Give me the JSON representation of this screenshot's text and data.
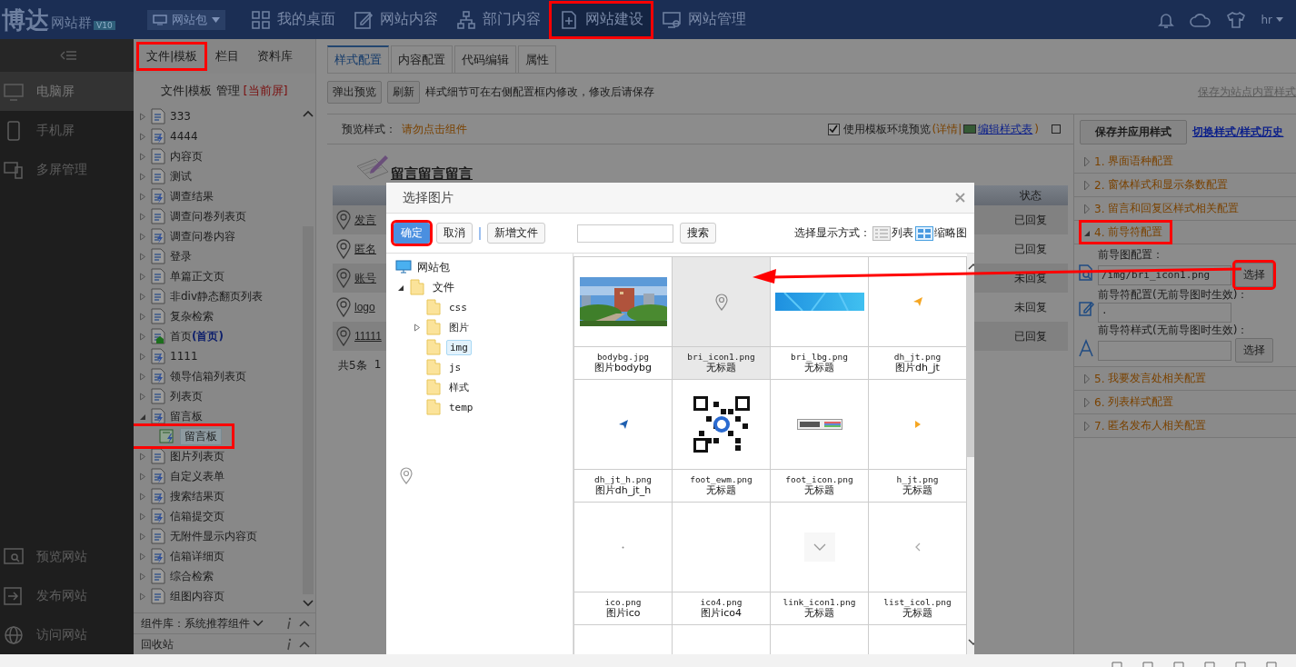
{
  "topbar": {
    "logo": "博达",
    "product": "网站群",
    "version": "V10",
    "site_select": "网站包",
    "user": "hr",
    "nav": [
      {
        "label": "我的桌面",
        "kind": "grid",
        "selected": false,
        "marked": false
      },
      {
        "label": "网站内容",
        "kind": "edit",
        "selected": false,
        "marked": false
      },
      {
        "label": "部门内容",
        "kind": "sitemap",
        "selected": false,
        "marked": false
      },
      {
        "label": "网站建设",
        "kind": "add-page",
        "selected": true,
        "marked": true
      },
      {
        "label": "网站管理",
        "kind": "monitor",
        "selected": false,
        "marked": false
      }
    ]
  },
  "sidebar": {
    "items": [
      {
        "label": "电脑屏",
        "kind": "monitor",
        "selected": true
      },
      {
        "label": "手机屏",
        "kind": "phone",
        "selected": false
      },
      {
        "label": "多屏管理",
        "kind": "multi",
        "selected": false
      }
    ],
    "bottom_items": [
      {
        "label": "预览网站",
        "kind": "preview"
      },
      {
        "label": "发布网站",
        "kind": "publish"
      },
      {
        "label": "访问网站",
        "kind": "globe"
      }
    ]
  },
  "tree_panel": {
    "tabs": [
      {
        "label": "文件|模板",
        "marked": true
      },
      {
        "label": "栏目",
        "marked": false
      },
      {
        "label": "资料库",
        "marked": false
      }
    ],
    "heading": "文件|模板 管理",
    "heading_badge": "[当前屏]",
    "items": [
      {
        "label": "333",
        "kind": "page",
        "expanded": false
      },
      {
        "label": "4444",
        "kind": "dynamic",
        "expanded": false
      },
      {
        "label": "内容页",
        "kind": "page",
        "expanded": false
      },
      {
        "label": "测试",
        "kind": "page",
        "expanded": false
      },
      {
        "label": "调查结果",
        "kind": "dynamic",
        "expanded": false
      },
      {
        "label": "调查问卷列表页",
        "kind": "page",
        "expanded": false
      },
      {
        "label": "调查问卷内容",
        "kind": "dynamic",
        "expanded": false
      },
      {
        "label": "登录",
        "kind": "page",
        "expanded": false
      },
      {
        "label": "单篇正文页",
        "kind": "page",
        "expanded": false
      },
      {
        "label": "非div静态翻页列表",
        "kind": "page",
        "expanded": false
      },
      {
        "label": "复杂检索",
        "kind": "page",
        "expanded": false
      },
      {
        "label": "首页",
        "tag": "(首页)",
        "kind": "home",
        "expanded": false
      },
      {
        "label": "1111",
        "kind": "dynamic",
        "expanded": false
      },
      {
        "label": "领导信箱列表页",
        "kind": "dynamic",
        "expanded": false
      },
      {
        "label": "列表页",
        "kind": "page",
        "expanded": false
      },
      {
        "label": "留言板",
        "kind": "dynamic",
        "expanded": true,
        "children": [
          {
            "label": "留言板",
            "kind": "edit",
            "selected": true,
            "marked": true
          }
        ]
      },
      {
        "label": "图片列表页",
        "kind": "page",
        "expanded": false
      },
      {
        "label": "自定义表单",
        "kind": "dynamic",
        "expanded": false
      },
      {
        "label": "搜索结果页",
        "kind": "dynamic",
        "expanded": false
      },
      {
        "label": "信箱提交页",
        "kind": "dynamic",
        "expanded": false
      },
      {
        "label": "无附件显示内容页",
        "kind": "page",
        "expanded": false
      },
      {
        "label": "信箱详细页",
        "kind": "dynamic",
        "expanded": false
      },
      {
        "label": "综合检索",
        "kind": "page",
        "expanded": false
      },
      {
        "label": "组图内容页",
        "kind": "page",
        "expanded": false
      }
    ],
    "footer": [
      {
        "label": "组件库：系统推荐组件",
        "dropdown": true
      },
      {
        "label": "回收站",
        "dropdown": false
      }
    ]
  },
  "main": {
    "tabs": [
      {
        "label": "样式配置",
        "selected": true
      },
      {
        "label": "内容配置",
        "selected": false
      },
      {
        "label": "代码编辑",
        "selected": false
      },
      {
        "label": "属性",
        "selected": false
      }
    ],
    "buttons": [
      "弹出预览",
      "刷新"
    ],
    "hint": "样式细节可在右侧配置框内修改，修改后请保存",
    "save_link": "保存为站点内置样式"
  },
  "preview": {
    "label": "预览样式：",
    "notice": "请勿点击组件",
    "env_checkbox": {
      "label": "使用模板环境预览",
      "checked": true
    },
    "details": "(详情|",
    "stylesheet_link": "编辑样式表",
    "close_paren": ")",
    "title": "留言留言留言",
    "status_header": "状态",
    "rows": [
      {
        "title": "发言",
        "status": "已回复"
      },
      {
        "title": "匿名",
        "status": "已回复"
      },
      {
        "title": "账号",
        "status": "未回复"
      },
      {
        "title": "logo",
        "status": "未回复"
      },
      {
        "title": "11111",
        "status": "已回复"
      }
    ],
    "count": "共5条",
    "pager": "1"
  },
  "config": {
    "save_button": "保存并应用样式",
    "history_link": "切换样式/样式历史",
    "sections": [
      {
        "number": "1.",
        "label": "界面语种配置",
        "expanded": false,
        "marked": false
      },
      {
        "number": "2.",
        "label": "窗体样式和显示条数配置",
        "expanded": false,
        "marked": false
      },
      {
        "number": "3.",
        "label": "留言和回复区样式相关配置",
        "expanded": false,
        "marked": false
      },
      {
        "number": "4.",
        "label": "前导符配置",
        "expanded": true,
        "marked": true,
        "fields": [
          {
            "label": "前导图配置：",
            "kind": "image-search",
            "value": "/img/bri_icon1.png",
            "button": "选择",
            "marked": true
          },
          {
            "label": "前导符配置(无前导图时生效)：",
            "kind": "edit",
            "value": "·"
          },
          {
            "label": "前导符样式(无前导图时生效)：",
            "kind": "font",
            "button": "选择",
            "marked": false
          }
        ]
      },
      {
        "number": "5.",
        "label": "我要发言处相关配置",
        "expanded": false,
        "marked": false
      },
      {
        "number": "6.",
        "label": "列表样式配置",
        "expanded": false,
        "marked": false
      },
      {
        "number": "7.",
        "label": "匿名发布人相关配置",
        "expanded": false,
        "marked": false
      }
    ]
  },
  "dialog": {
    "title": "选择图片",
    "buttons": [
      {
        "label": "确定",
        "kind": "primary",
        "marked": true
      },
      {
        "label": "取消",
        "kind": "normal",
        "marked": false
      },
      {
        "label": "新增文件",
        "kind": "normal",
        "marked": false
      }
    ],
    "search_button": "搜索",
    "view_label": "选择显示方式：",
    "views": [
      {
        "label": "列表",
        "selected": false
      },
      {
        "label": "缩略图",
        "selected": true
      }
    ],
    "tree": {
      "label": "网站包",
      "children": [
        {
          "label": "文件",
          "expanded": true,
          "children": [
            {
              "label": "css",
              "selected": false
            },
            {
              "label": "图片",
              "selected": false,
              "has_children": true
            },
            {
              "label": "img",
              "selected": true
            },
            {
              "label": "js",
              "selected": false
            },
            {
              "label": "样式",
              "selected": false
            },
            {
              "label": "temp",
              "selected": false
            }
          ]
        }
      ]
    },
    "files": [
      {
        "name": "bodybg.jpg",
        "title": "图片bodybg",
        "selected": false
      },
      {
        "name": "bri_icon1.png",
        "title": "无标题",
        "kind": "pin",
        "selected": true
      },
      {
        "name": "bri_lbg.png",
        "title": "无标题",
        "kind": "banner",
        "selected": false
      },
      {
        "name": "dh_jt.png",
        "title": "图片dh_jt",
        "kind": "arrow-orange",
        "selected": false
      },
      {
        "name": "dh_jt_h.png",
        "title": "图片dh_jt_h",
        "kind": "arrow-blue",
        "selected": false
      },
      {
        "name": "foot_ewm.png",
        "title": "无标题",
        "kind": "qr",
        "selected": false
      },
      {
        "name": "foot_icon.png",
        "title": "无标题",
        "kind": "badge",
        "selected": false
      },
      {
        "name": "h_jt.png",
        "title": "无标题",
        "kind": "triangle",
        "selected": false
      },
      {
        "name": "ico.png",
        "title": "图片ico",
        "kind": "dot",
        "selected": false
      },
      {
        "name": "ico4.png",
        "title": "图片ico4",
        "kind": "blank",
        "selected": false
      },
      {
        "name": "link_icon1.png",
        "title": "无标题",
        "kind": "chevron-down",
        "selected": false
      },
      {
        "name": "list_icol.png",
        "title": "无标题",
        "kind": "chevron-left",
        "selected": false
      },
      {
        "kind": "blank",
        "selected": false
      },
      {
        "kind": "blank",
        "selected": false
      },
      {
        "kind": "blank",
        "selected": false
      },
      {
        "kind": "blank",
        "selected": false
      }
    ]
  }
}
